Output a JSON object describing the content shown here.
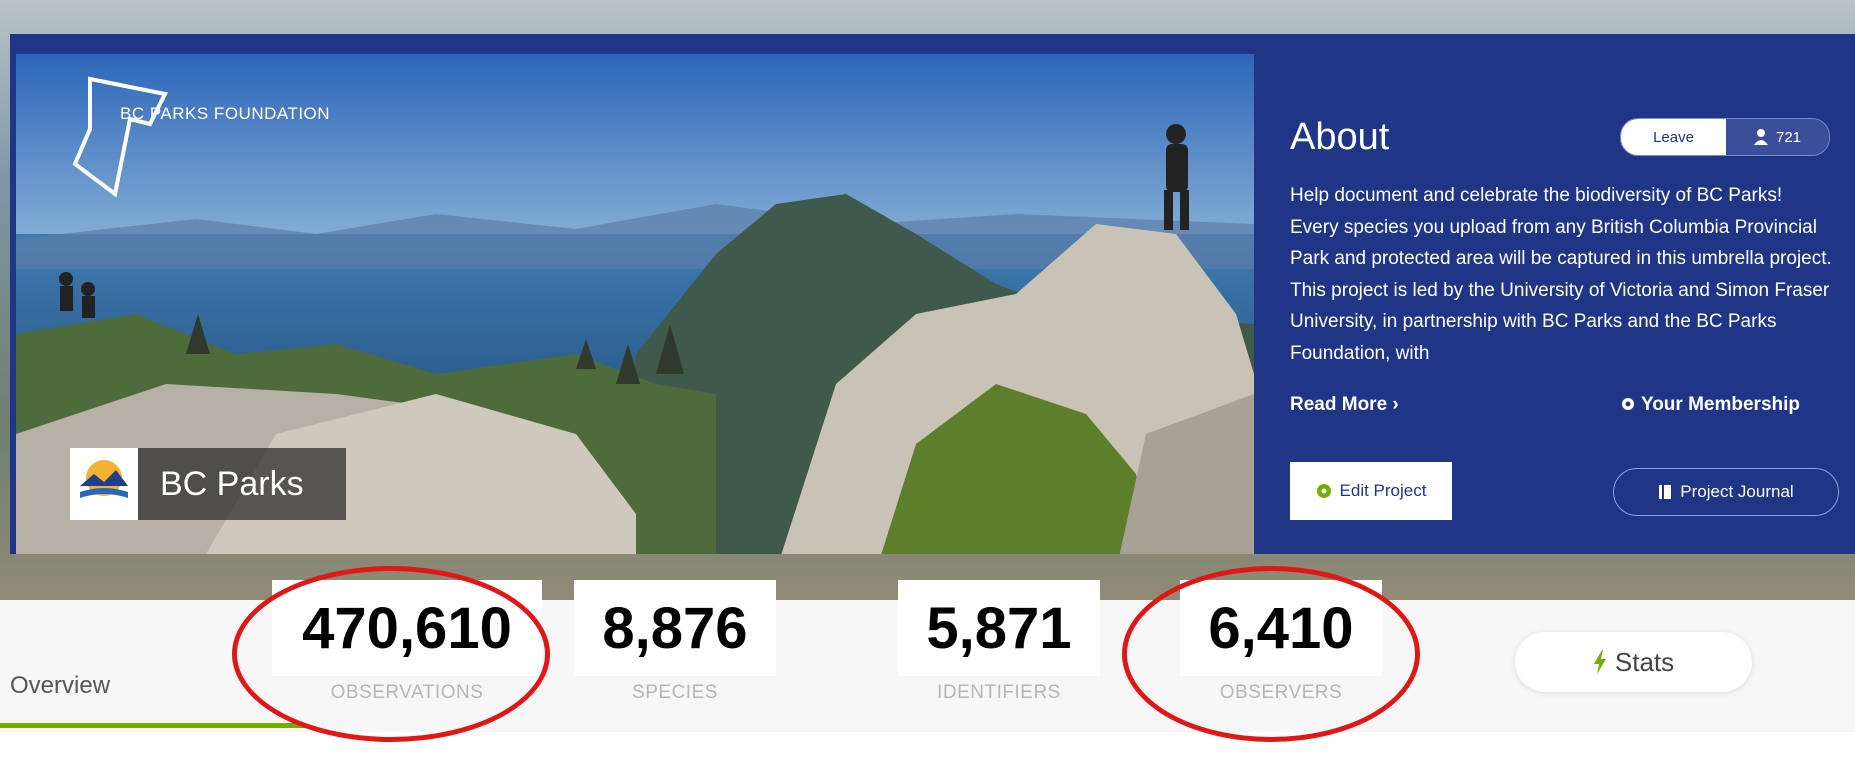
{
  "brand": {
    "foundation_logo_text": "BC PARKS FOUNDATION",
    "badge_logo_text": "BCParks"
  },
  "project": {
    "name": "BC Parks"
  },
  "about": {
    "title": "About",
    "leave_label": "Leave",
    "member_count": "721",
    "description": "Help document and celebrate the biodiversity of BC Parks! Every species you upload from any British Columbia Provincial Park and protected area will be captured in this umbrella project. This project is led by the University of Victoria and Simon Fraser University, in partnership with BC Parks and the BC Parks Foundation, with",
    "read_more": "Read More ›",
    "membership": "Your Membership",
    "edit_project": "Edit Project",
    "project_journal": "Project Journal"
  },
  "tabs": {
    "overview": "Overview"
  },
  "stats": {
    "observations": {
      "value": "470,610",
      "label": "OBSERVATIONS"
    },
    "species": {
      "value": "8,876",
      "label": "SPECIES"
    },
    "identifiers": {
      "value": "5,871",
      "label": "IDENTIFIERS"
    },
    "observers": {
      "value": "6,410",
      "label": "OBSERVERS"
    },
    "stats_button": "Stats"
  },
  "colors": {
    "panel": "#1f3585",
    "accent_green": "#74ac00",
    "highlight_red": "#e01717"
  },
  "icons": [
    "person-icon",
    "gear-icon",
    "edit-icon",
    "journal-icon",
    "lightning-icon"
  ]
}
